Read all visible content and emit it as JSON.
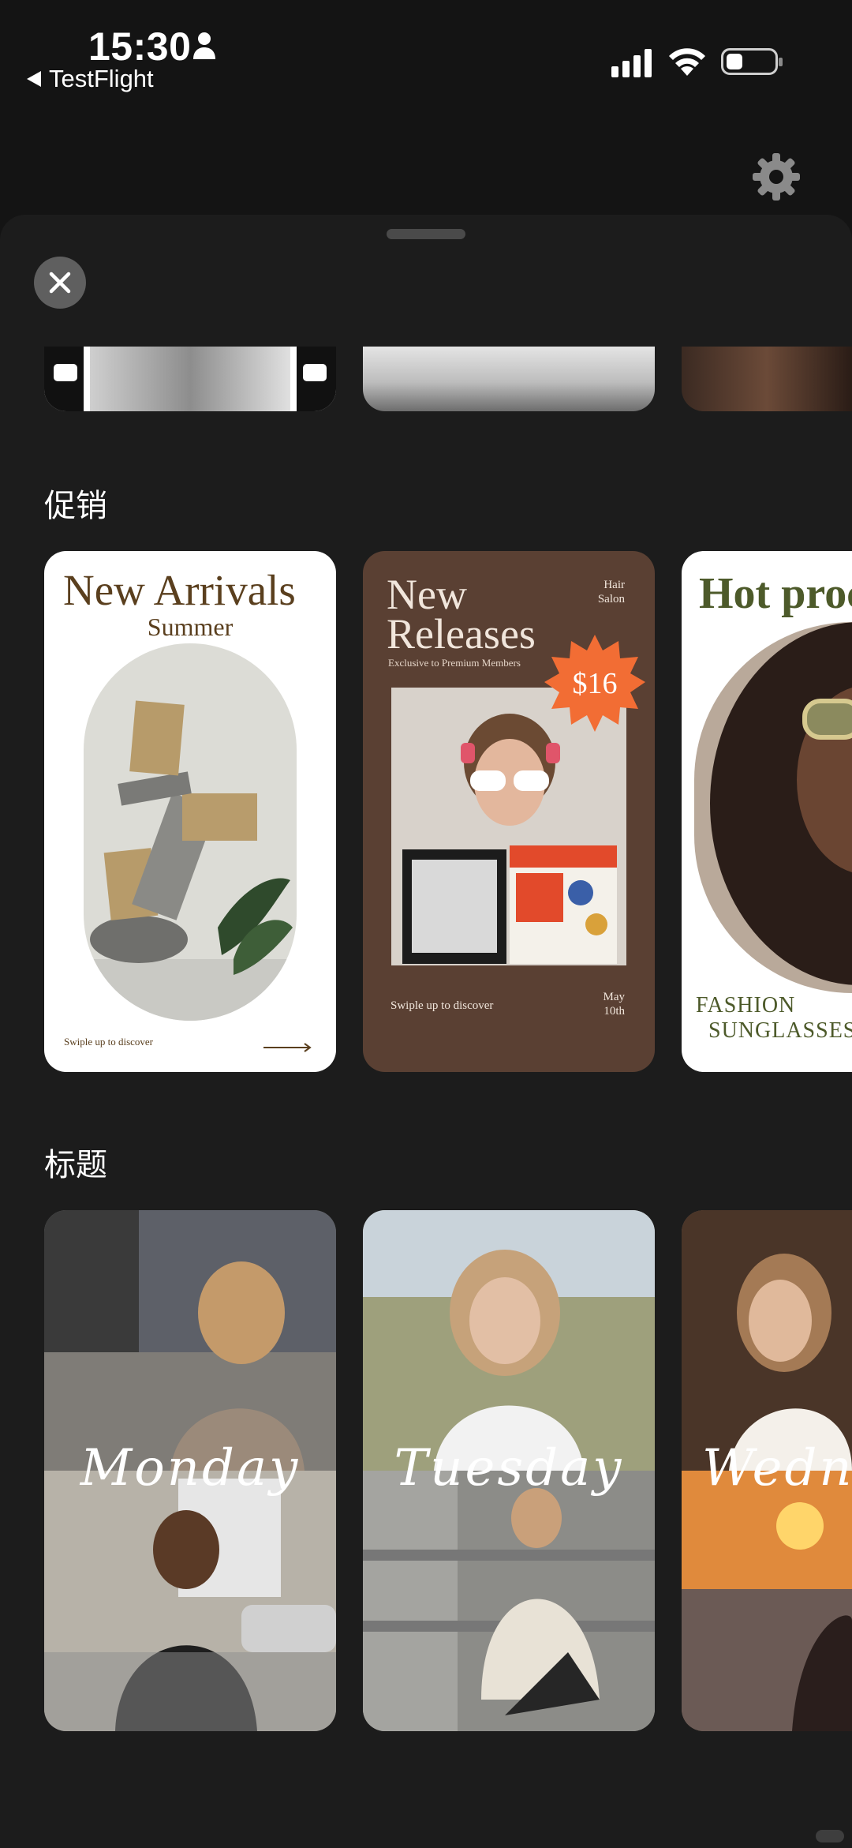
{
  "status_bar": {
    "time": "15:30",
    "back_app": "TestFlight",
    "icons": [
      "person-icon",
      "cellular-signal-icon",
      "wifi-icon",
      "battery-icon"
    ]
  },
  "header": {
    "settings_icon": "gear-icon"
  },
  "sheet": {
    "close_icon": "close-icon",
    "sections": [
      {
        "title": "促销",
        "cards": [
          {
            "title": "New Arrivals",
            "subtitle": "Summer",
            "footer": "Swiple up to discover"
          },
          {
            "title_line1": "New",
            "title_line2": "Releases",
            "tagline": "Exclusive to Premium Members",
            "badge": "$16",
            "corner_line1": "Hair",
            "corner_line2": "Salon",
            "footer": "Swiple up to discover",
            "date_line1": "May",
            "date_line2": "10th"
          },
          {
            "title": "Hot proc",
            "footer_line1": "FASHION",
            "footer_line2": "SUNGLASSES"
          }
        ]
      },
      {
        "title": "标题",
        "cards": [
          {
            "label": "Monday"
          },
          {
            "label": "Tuesday"
          },
          {
            "label": "Wednes"
          }
        ]
      }
    ]
  },
  "colors": {
    "background": "#141414",
    "sheet": "#1c1c1c",
    "brown_card": "#5a4033",
    "badge": "#f26d34",
    "olive_text": "#4d5a2a"
  }
}
